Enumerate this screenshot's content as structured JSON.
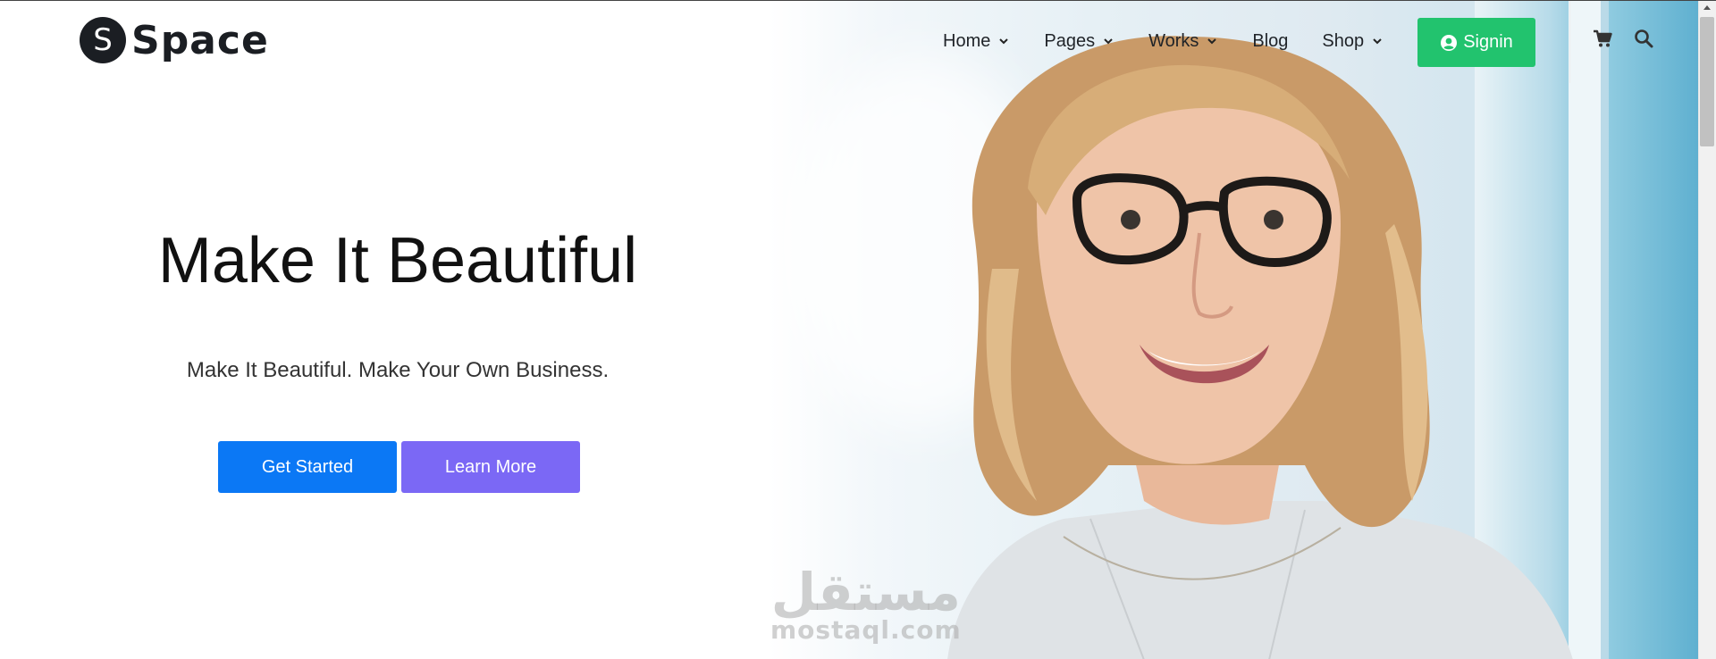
{
  "brand": {
    "logo_letter": "S",
    "name": "Space"
  },
  "nav": {
    "items": [
      {
        "label": "Home",
        "has_dropdown": true
      },
      {
        "label": "Pages",
        "has_dropdown": true
      },
      {
        "label": "Works",
        "has_dropdown": true
      },
      {
        "label": "Blog",
        "has_dropdown": false
      },
      {
        "label": "Shop",
        "has_dropdown": true
      }
    ],
    "signin_label": "Signin",
    "icons": [
      "user-circle-icon",
      "cart-icon",
      "search-icon"
    ]
  },
  "hero": {
    "title": "Make It Beautiful",
    "subtitle": "Make It Beautiful. Make Your Own Business.",
    "primary_button": "Get Started",
    "secondary_button": "Learn More"
  },
  "watermark": {
    "arabic": "مستقل",
    "latin": "mostaql.com"
  },
  "colors": {
    "signin": "#22c36e",
    "primary_button": "#0b78f5",
    "secondary_button": "#7b68f5",
    "logo_badge": "#1b1e23"
  }
}
